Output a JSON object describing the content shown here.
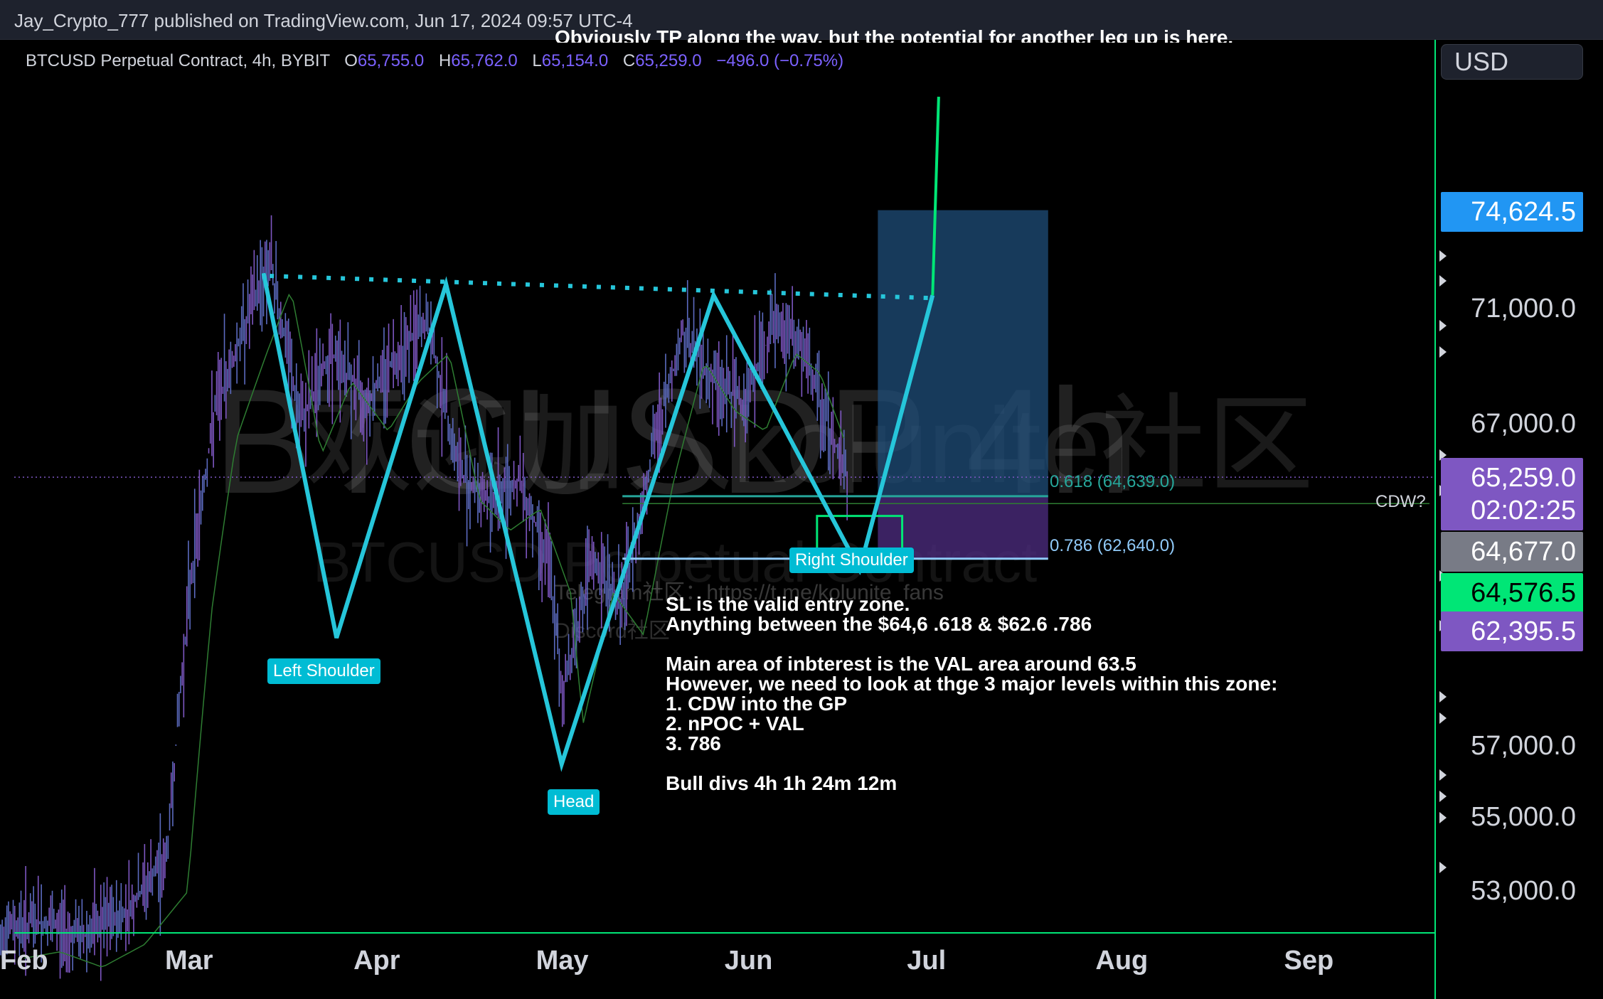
{
  "header": {
    "publisher": "Jay_Crypto_777 published on TradingView.com, Jun 17, 2024 09:57 UTC-4"
  },
  "legend": {
    "symbol": "BTCUSD Perpetual Contract, 4h, BYBIT",
    "o_label": "O",
    "o": "65,755.0",
    "h_label": "H",
    "h": "65,762.0",
    "l_label": "L",
    "l": "65,154.0",
    "c_label": "C",
    "c": "65,259.0",
    "change": "−496.0 (−0.75%)"
  },
  "currency": "USD",
  "top_note": "Obviously TP along the way, but the potential for another leg up is here.",
  "watermark": {
    "symbol": "BTCUSDP 4h",
    "chinese": "欢迎加入kolunite社区",
    "sub": "BTCUSD Perpetual Contract",
    "telegram": "Telegram社区：https://t.me/kolunite_fans",
    "discord": "Discord社区"
  },
  "price_badges": [
    {
      "label": "74,624.5",
      "color": "#2196f3"
    },
    {
      "label": "65,259.0",
      "color": "#7e57c2"
    },
    {
      "label": "02:02:25",
      "color": "#7e57c2"
    },
    {
      "label": "64,677.0",
      "color": "#787b86"
    },
    {
      "label": "64,576.5",
      "color": "#00e676"
    },
    {
      "label": "62,395.5",
      "color": "#7e57c2"
    }
  ],
  "fib_levels": [
    {
      "label": "0.618 (64,639.0)",
      "color": "#26a69a"
    },
    {
      "label": "0.786 (62,640.0)",
      "color": "#90caf9"
    }
  ],
  "cdw_label": "CDW?",
  "pattern_labels": {
    "left_shoulder": "Left Shoulder",
    "head": "Head",
    "right_shoulder": "Right Shoulder"
  },
  "note": "SL is the valid entry zone.\nAnything between the $64,6 .618 & $62.6 .786\n\nMain area of inbterest is the VAL area around 63.5\nHowever, we need to look at thge 3 major levels within this zone:\n1. CDW into the GP\n2. nPOC + VAL\n3. 786\n\nBull divs 4h 1h 24m 12m",
  "colors": {
    "pattern": "#26c6da",
    "projection": "#00e676",
    "candles": "#5c6bc0",
    "position_box": "#1f4e79"
  },
  "chart_data": {
    "type": "line",
    "title": "BTCUSD Perpetual Contract, 4h, BYBIT",
    "xlabel": "",
    "ylabel": "",
    "x_tick_labels": [
      "Feb",
      "Mar",
      "Apr",
      "May",
      "Jun",
      "Jul",
      "Aug",
      "Sep"
    ],
    "y_tick_labels": [
      "71,000.0",
      "67,000.0",
      "57,000.0",
      "55,000.0",
      "53,000.0"
    ],
    "y_scale": "log",
    "ylim": [
      51500,
      78000
    ],
    "grid": false,
    "series": [
      {
        "name": "",
        "x": [
          "2024-01-29",
          "2024-02-05",
          "2024-02-12",
          "2024-02-19",
          "2024-02-26",
          "2024-03-01",
          "2024-03-05",
          "2024-03-10",
          "2024-03-14",
          "2024-03-19",
          "2024-03-24",
          "2024-03-30",
          "2024-04-04",
          "2024-04-09",
          "2024-04-14",
          "2024-04-19",
          "2024-04-24",
          "2024-04-29",
          "2024-05-01",
          "2024-05-06",
          "2024-05-11",
          "2024-05-16",
          "2024-05-21",
          "2024-05-26",
          "2024-05-31",
          "2024-06-05",
          "2024-06-09",
          "2024-06-13",
          "2024-06-17"
        ],
        "values": [
          52000,
          52200,
          51800,
          52400,
          53800,
          62000,
          67500,
          70500,
          72800,
          67000,
          69500,
          67800,
          69500,
          70500,
          65500,
          64500,
          65200,
          62500,
          58500,
          62500,
          61200,
          66200,
          70200,
          68500,
          67800,
          70500,
          69800,
          67500,
          65259
        ]
      }
    ],
    "pattern_line": {
      "x": [
        "2024-03-13",
        "2024-03-25",
        "2024-04-12",
        "2024-05-01",
        "2024-05-26",
        "2024-06-19",
        "2024-07-01"
      ],
      "values": [
        72300,
        60200,
        71900,
        56500,
        71500,
        62300,
        71500
      ]
    },
    "neckline": {
      "x": [
        "2024-03-14",
        "2024-07-01"
      ],
      "values": [
        72200,
        71400
      ]
    },
    "projection": {
      "x": [
        "2024-07-01",
        "2024-07-02"
      ],
      "values": [
        71500,
        79000
      ]
    },
    "fib_618": 64639,
    "fib_786": 62640,
    "position_box": {
      "x": [
        "2024-06-22",
        "2024-07-20"
      ],
      "target": 74624.5,
      "entry": 64639,
      "stop": 62640
    }
  }
}
